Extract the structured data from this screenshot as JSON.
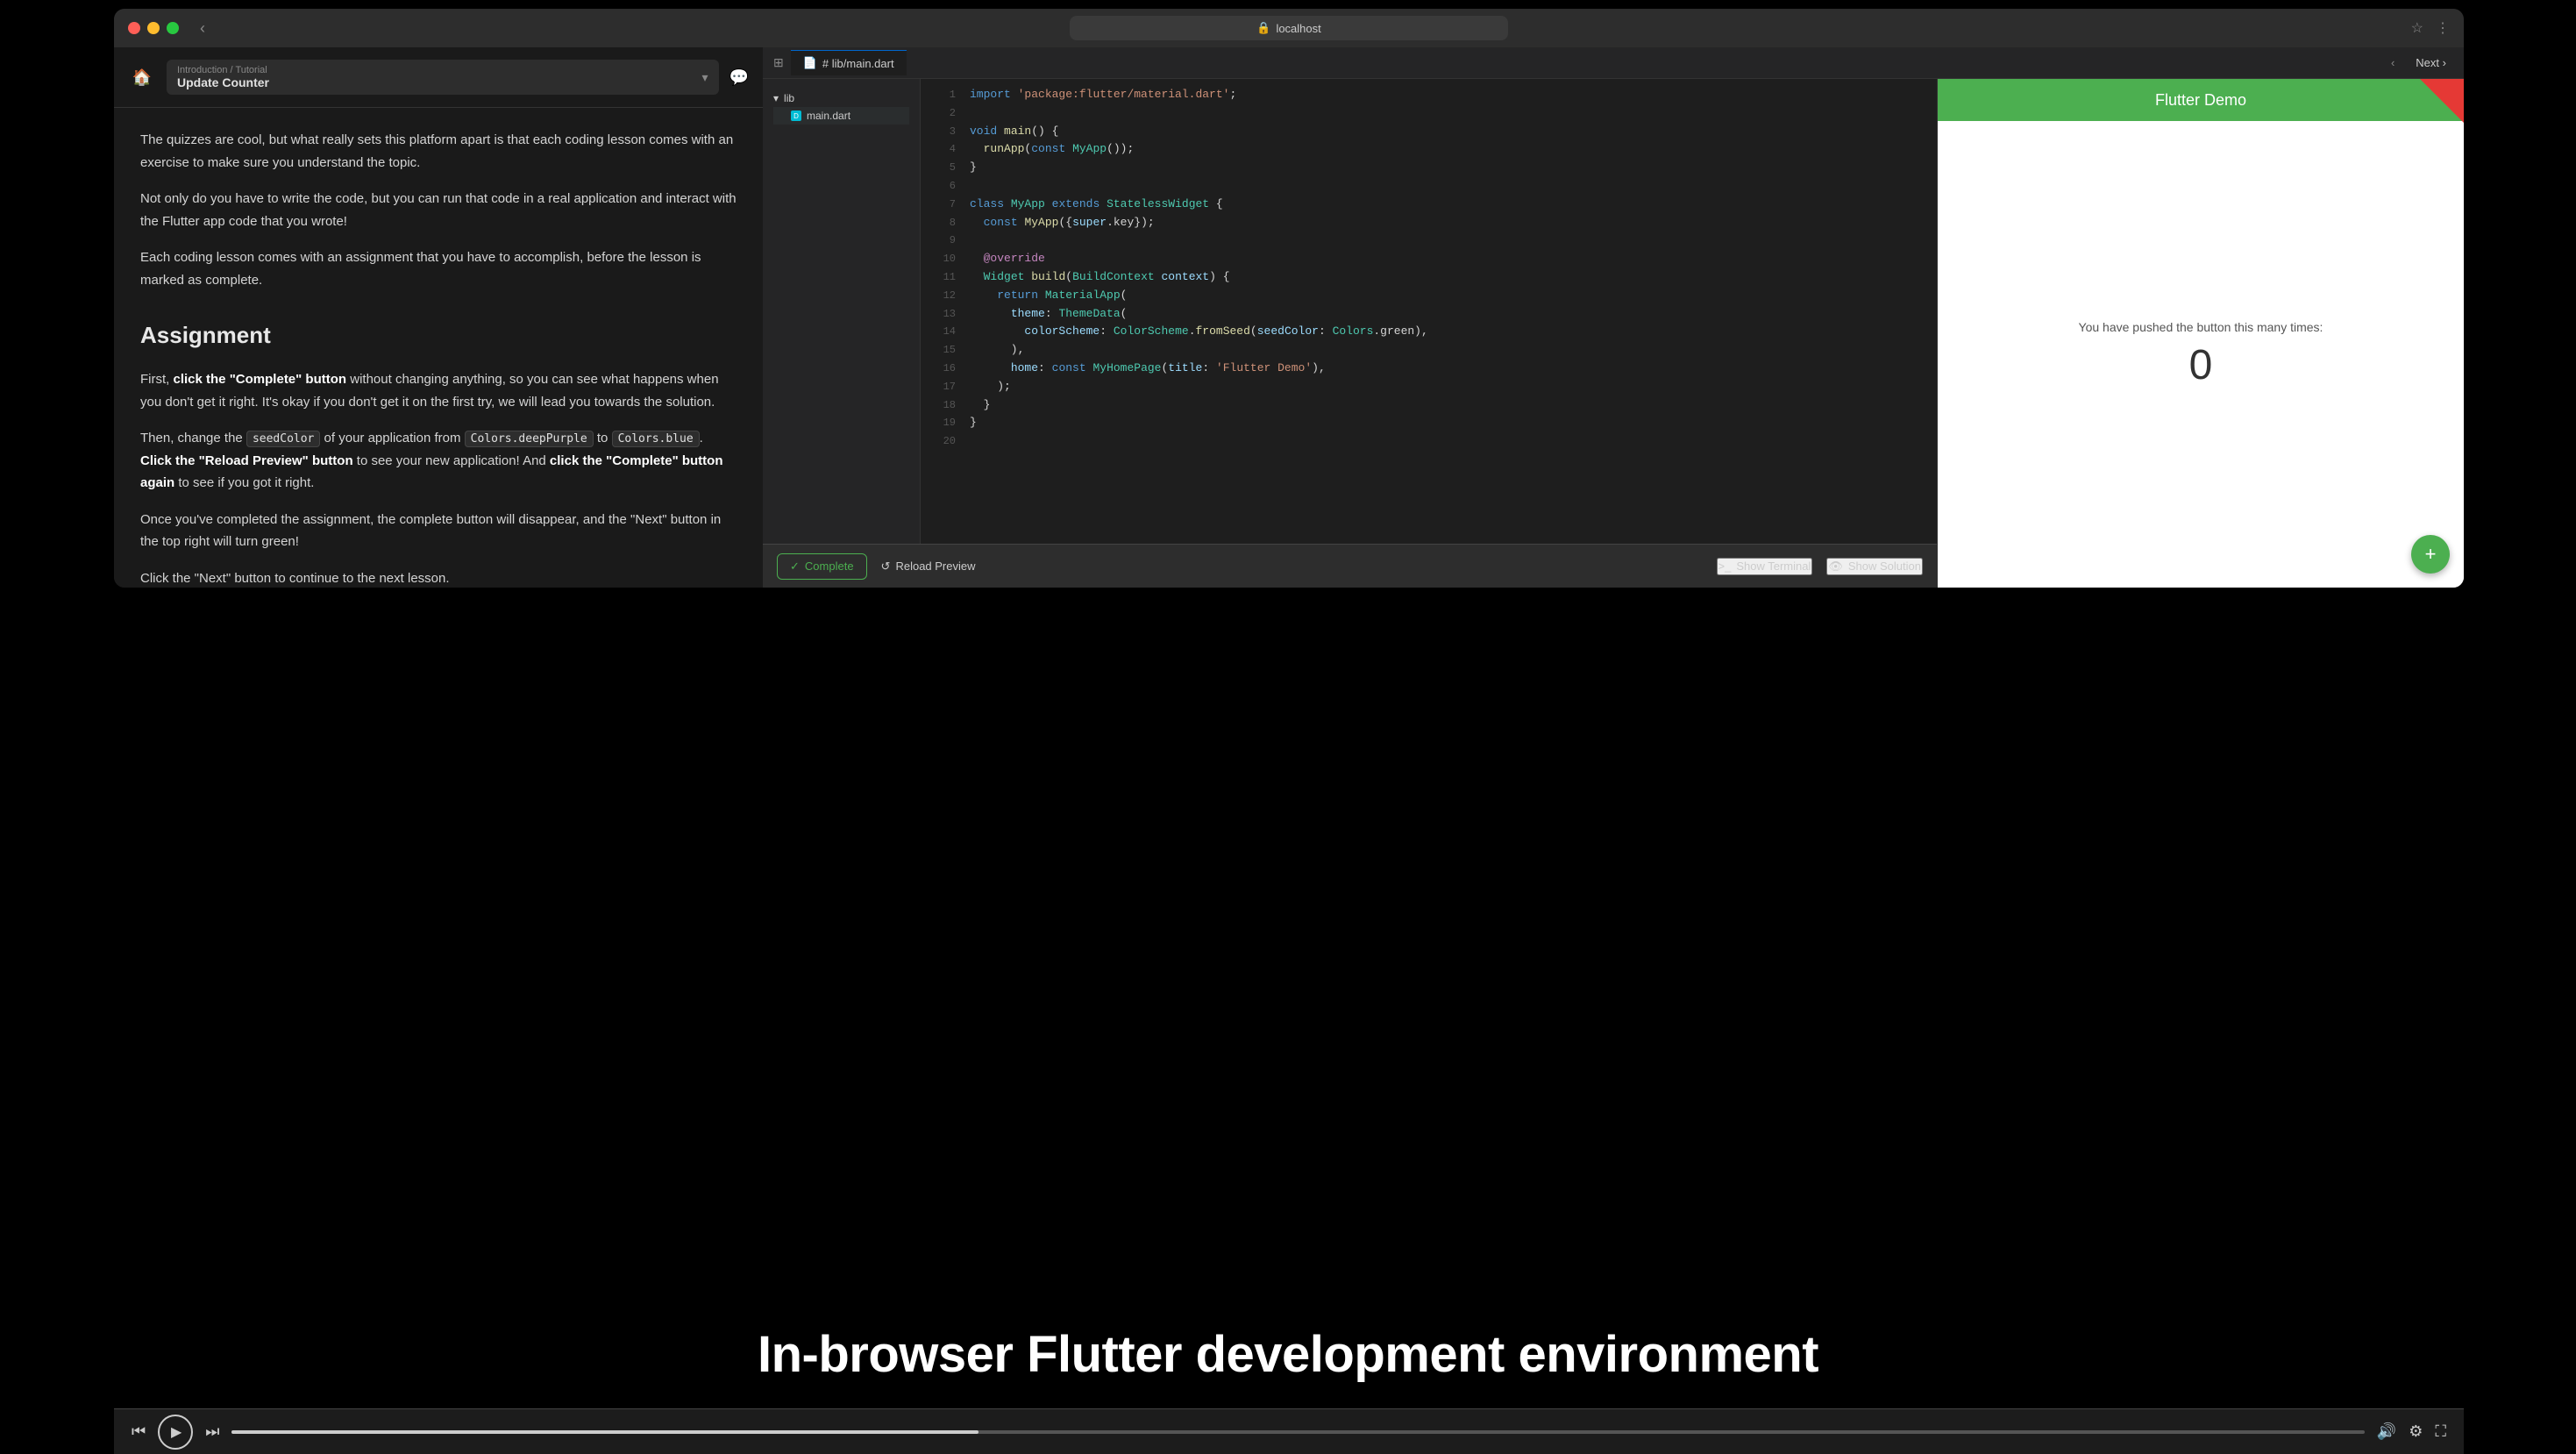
{
  "browser": {
    "url": "localhost",
    "back_label": "‹",
    "traffic_lights": [
      "red",
      "yellow",
      "green"
    ]
  },
  "lesson": {
    "breadcrumb_sub": "Introduction / Tutorial",
    "breadcrumb_title": "Update Counter",
    "paragraphs": [
      "The quizzes are cool, but what really sets this platform apart is that each coding lesson comes with an exercise to make sure you understand the topic.",
      "Not only do you have to write the code, but you can run that code in a real application and interact with the Flutter app code that you wrote!",
      "Each coding lesson comes with an assignment that you have to accomplish, before the lesson is marked as complete."
    ],
    "assignment_title": "Assignment",
    "assignment_p1_pre": "First, ",
    "assignment_p1_bold": "click the \"Complete\" button",
    "assignment_p1_post": " without changing anything, so you can see what happens when you don't get it right. It's okay if you don't get it on the first try, we will lead you towards the solution.",
    "assignment_p2_pre": "Then, change the ",
    "assignment_p2_code1": "seedColor",
    "assignment_p2_mid1": " of your application from ",
    "assignment_p2_code2": "Colors.deepPurple",
    "assignment_p2_mid2": " to ",
    "assignment_p2_code3": "Colors.blue",
    "assignment_p2_post_pre": ". ",
    "assignment_p2_bold1": "Click the \"Reload Preview\" button",
    "assignment_p2_mid3": " to see your new application! And ",
    "assignment_p2_bold2": "click the \"Complete\" button again",
    "assignment_p2_end": " to see if you got it right.",
    "assignment_p3": "Once you've completed the assignment, the complete button will disappear, and the \"Next\" button in the top right will turn green!",
    "assignment_p4": "Click the \"Next\" button to continue to the next lesson."
  },
  "editor": {
    "file_tab": "# lib/main.dart",
    "dir_name": "lib",
    "file_name": "main.dart",
    "nav_prev": "‹",
    "nav_next": "Next",
    "code_lines": [
      {
        "num": "1",
        "code": "import 'package:flutter/material.dart';"
      },
      {
        "num": "2",
        "code": ""
      },
      {
        "num": "3",
        "code": "void main() {"
      },
      {
        "num": "4",
        "code": "  runApp(const MyApp());"
      },
      {
        "num": "5",
        "code": "}"
      },
      {
        "num": "6",
        "code": ""
      },
      {
        "num": "7",
        "code": "class MyApp extends StatelessWidget {"
      },
      {
        "num": "8",
        "code": "  const MyApp({super.key});"
      },
      {
        "num": "9",
        "code": ""
      },
      {
        "num": "10",
        "code": "  @override"
      },
      {
        "num": "11",
        "code": "  Widget build(BuildContext context) {"
      },
      {
        "num": "12",
        "code": "    return MaterialApp("
      },
      {
        "num": "13",
        "code": "      theme: ThemeData("
      },
      {
        "num": "14",
        "code": "        colorScheme: ColorScheme.fromSeed(seedColor: Colors.green),"
      },
      {
        "num": "15",
        "code": "      ),"
      },
      {
        "num": "16",
        "code": "      home: const MyHomePage(title: 'Flutter Demo'),"
      },
      {
        "num": "17",
        "code": "    );"
      },
      {
        "num": "18",
        "code": "  }"
      },
      {
        "num": "19",
        "code": "}"
      },
      {
        "num": "20",
        "code": ""
      }
    ]
  },
  "toolbar": {
    "complete_label": "Complete",
    "reload_label": "Reload Preview",
    "terminal_label": "Show Terminal",
    "solution_label": "Show Solution"
  },
  "flutter_app": {
    "title": "Flutter Demo",
    "body_text": "You have pushed the button this many times:",
    "counter": "0",
    "fab_icon": "+"
  },
  "video_controls": {
    "play_icon": "▶"
  },
  "caption": {
    "text": "In-browser Flutter development environment"
  },
  "top_nav": {
    "next_label": "Next"
  }
}
